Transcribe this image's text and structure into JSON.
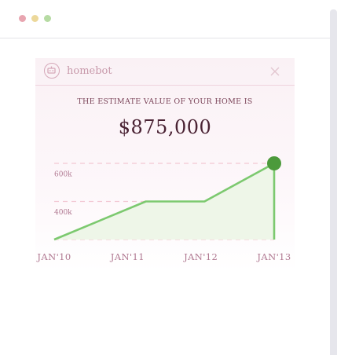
{
  "window": {
    "controls": [
      "close",
      "minimize",
      "maximize"
    ]
  },
  "widget": {
    "brand": "homebot",
    "logo_icon": "robot-icon",
    "close_icon": "close-icon",
    "subtitle": "THE ESTIMATE VALUE OF YOUR HOME IS",
    "value": "$875,000"
  },
  "colors": {
    "line": "#7cc96f",
    "area": "#eef6e8",
    "marker": "#4c9a3b",
    "grid": "#f2c8d3",
    "tick_text": "#b07891",
    "title_text": "#7b4459"
  },
  "chart_data": {
    "type": "area",
    "x": [
      "JAN'10",
      "JAN'11",
      "JAN'12",
      "JAN'13"
    ],
    "series": [
      {
        "points": [
          [
            0,
            300
          ],
          [
            1.25,
            500
          ],
          [
            2.05,
            500
          ],
          [
            3.0,
            700
          ]
        ]
      }
    ],
    "y_ticks": [
      {
        "value": 400,
        "label": "400k"
      },
      {
        "value": 600,
        "label": "600k"
      }
    ],
    "ylim": [
      300,
      700
    ],
    "grid": true,
    "gridlines": [
      300,
      500,
      700
    ],
    "highlight_last_point": true
  }
}
